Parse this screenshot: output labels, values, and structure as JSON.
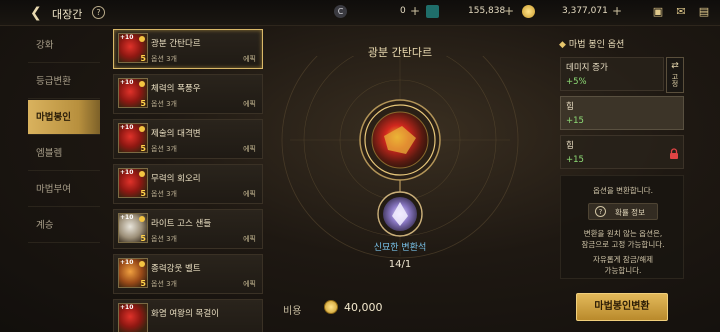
{
  "topbar": {
    "title": "대장간",
    "help": "?",
    "currency1_icon": "C",
    "currency1_value": "0",
    "currency2_value": "155,838",
    "currency3_value": "3,377,071",
    "plus": "+",
    "icons": [
      "chest-icon",
      "mail-icon",
      "chat-icon"
    ]
  },
  "nav": {
    "items": [
      {
        "label": "강화"
      },
      {
        "label": "등급변환"
      },
      {
        "label": "마법봉인"
      },
      {
        "label": "엠블렘"
      },
      {
        "label": "마법부여"
      },
      {
        "label": "계승"
      }
    ]
  },
  "list": {
    "items": [
      {
        "name": "광분 간탄다르",
        "option": "옵션 3개",
        "grade": "에픽",
        "level": "+10",
        "tier": "5"
      },
      {
        "name": "체력의 폭풍우",
        "option": "옵션 3개",
        "grade": "에픽",
        "level": "+10",
        "tier": "5"
      },
      {
        "name": "제술의 대격변",
        "option": "옵션 3개",
        "grade": "에픽",
        "level": "+10",
        "tier": "5"
      },
      {
        "name": "무력의 회오리",
        "option": "옵션 3개",
        "grade": "에픽",
        "level": "+10",
        "tier": "5"
      },
      {
        "name": "라이트 고스 샌들",
        "option": "옵션 3개",
        "grade": "에픽",
        "level": "+10",
        "tier": "5"
      },
      {
        "name": "종력강웃 벨트",
        "option": "옵션 3개",
        "grade": "에픽",
        "level": "+10",
        "tier": "5"
      },
      {
        "name": "화염 여왕의 목걸이",
        "option": "",
        "grade": "",
        "level": "+10",
        "tier": ""
      }
    ]
  },
  "center": {
    "title": "광분 간탄다르",
    "material_name": "신묘한 변환석",
    "material_count": "14/1",
    "cost_label": "비용",
    "cost_value": "40,000"
  },
  "right": {
    "title": "마법 봉인 옵션",
    "options": [
      {
        "name": "데미지 증가",
        "value": "+5%"
      },
      {
        "name": "힘",
        "value": "+15"
      },
      {
        "name": "힘",
        "value": "+15"
      }
    ],
    "swap_label": "고정",
    "msg1": "옵션을 변환합니다.",
    "info_button": "확률 정보",
    "msg2a": "변환을 원치 않는 옵션은,",
    "msg2b": "잠금으로 고정 가능합니다.",
    "msg3a": "자유롭게 잠금/해제",
    "msg3b": "가능합니다.",
    "main_button": "마법봉인변환"
  }
}
